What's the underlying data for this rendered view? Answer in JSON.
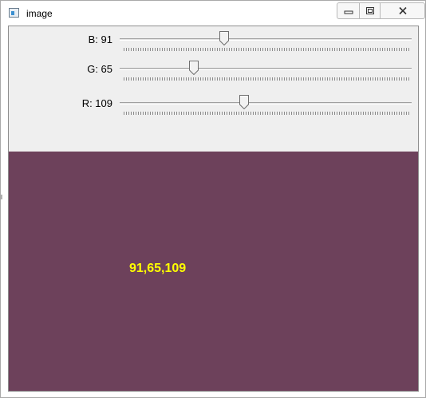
{
  "window": {
    "title": "image",
    "controls": {
      "minimize_icon": "minimize-icon",
      "maximize_icon": "maximize-icon",
      "close_icon": "close-icon"
    }
  },
  "trackbars": [
    {
      "label": "B: 91",
      "value": 91,
      "max": 255
    },
    {
      "label": "G: 65",
      "value": 65,
      "max": 255
    },
    {
      "label": "R: 109",
      "value": 109,
      "max": 255
    }
  ],
  "display": {
    "text": "91,65,109",
    "background_color": "#6d415b",
    "text_color": "#ffff00"
  }
}
